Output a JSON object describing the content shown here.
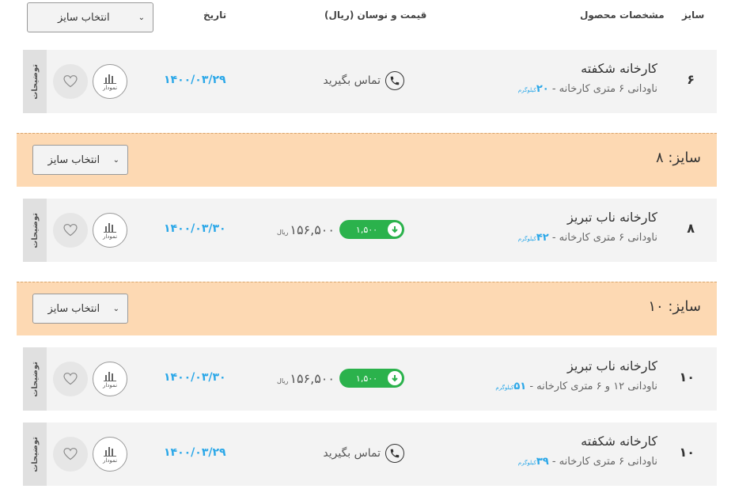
{
  "header": {
    "size": "سایز",
    "specs": "مشخصات محصول",
    "price": "قیمت و نوسان (ریال)",
    "date": "تاریخ",
    "select_label": "انتخاب سایز"
  },
  "groups": [
    {
      "title": "سایز:  ۸",
      "select_label": "انتخاب سایز"
    },
    {
      "title": "سایز:  ۱۰",
      "select_label": "انتخاب سایز"
    }
  ],
  "rows": [
    {
      "size": "۶",
      "title": "کارخانه شکفته",
      "desc": "ناودانی ۶ متری کارخانه - ",
      "weight": "۲۰",
      "weight_unit": "کیلوگرم",
      "contact": "تماس بگیرید",
      "date": "۱۴۰۰/۰۳/۲۹",
      "chart_label": "نمودار",
      "side_label": "توضیحات"
    },
    {
      "size": "۸",
      "title": "کارخانه ناب تبریز",
      "desc": "ناودانی ۶ متری کارخانه - ",
      "weight": "۴۲",
      "weight_unit": "کیلوگرم",
      "change": "۱,۵۰۰",
      "price": "۱۵۶,۵۰۰",
      "price_unit": "ریال",
      "date": "۱۴۰۰/۰۳/۳۰",
      "chart_label": "نمودار",
      "side_label": "توضیحات"
    },
    {
      "size": "۱۰",
      "title": "کارخانه ناب تبریز",
      "desc": "ناودانی ۱۲ و ۶ متری کارخانه - ",
      "weight": "۵۱",
      "weight_unit": "کیلوگرم",
      "change": "۱,۵۰۰",
      "price": "۱۵۶,۵۰۰",
      "price_unit": "ریال",
      "date": "۱۴۰۰/۰۳/۳۰",
      "chart_label": "نمودار",
      "side_label": "توضیحات"
    },
    {
      "size": "۱۰",
      "title": "کارخانه شکفته",
      "desc": "ناودانی ۶ متری کارخانه - ",
      "weight": "۳۹",
      "weight_unit": "کیلوگرم",
      "contact": "تماس بگیرید",
      "date": "۱۴۰۰/۰۳/۲۹",
      "chart_label": "نمودار",
      "side_label": "توضیحات"
    }
  ],
  "colors": {
    "accent": "#2aa7e8",
    "badge_green": "#2bb24c",
    "group_bg": "#fdd9b3",
    "row_bg": "#f3f3f3"
  }
}
